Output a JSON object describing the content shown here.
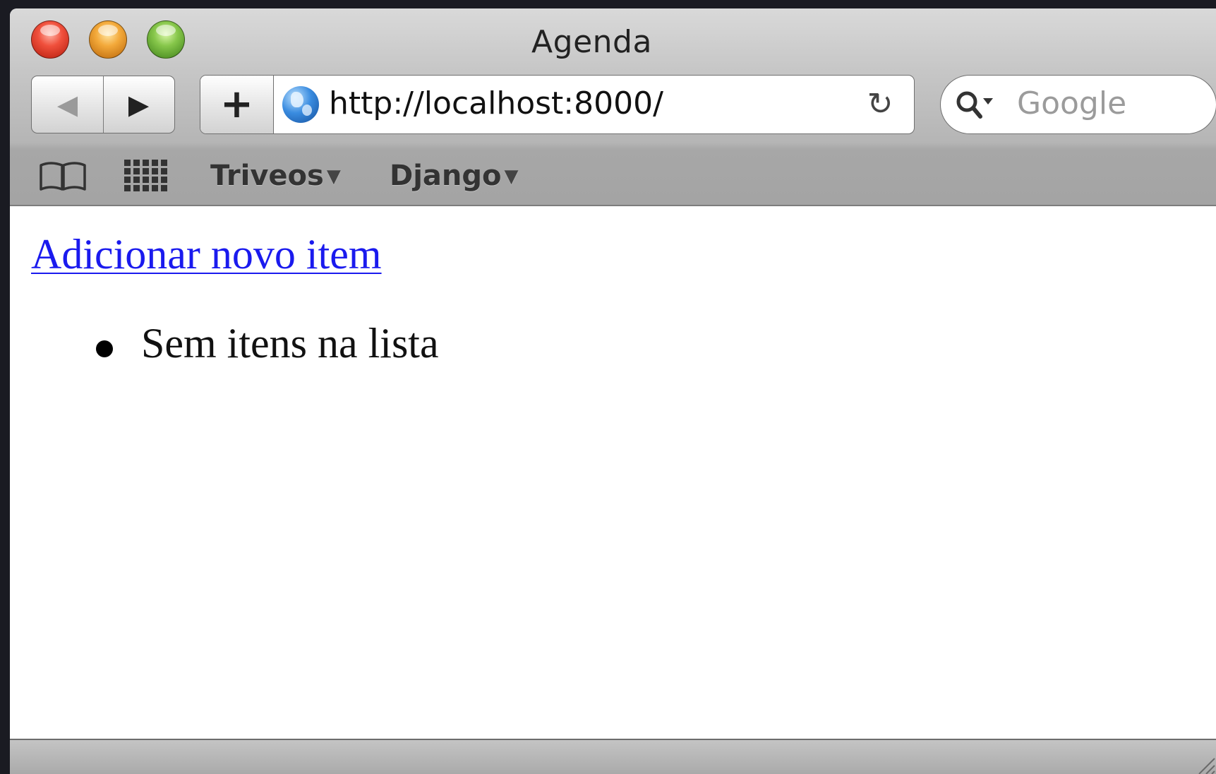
{
  "window": {
    "title": "Agenda"
  },
  "toolbar": {
    "back_label": "◀",
    "forward_label": "▶",
    "add_bookmark_label": "+",
    "url": "http://localhost:8000/",
    "reload_icon": "reload-icon",
    "search_placeholder": "Google"
  },
  "bookmarks_bar": {
    "items": [
      {
        "label": "Triveos",
        "has_menu": true
      },
      {
        "label": "Django",
        "has_menu": true
      }
    ]
  },
  "page": {
    "add_link": "Adicionar novo item",
    "list_items": [
      "Sem itens na lista"
    ]
  },
  "colors": {
    "link": "#1a1aee",
    "close_button": "#f0503c",
    "minimize_button": "#f3a93a",
    "zoom_button": "#86c64a"
  }
}
